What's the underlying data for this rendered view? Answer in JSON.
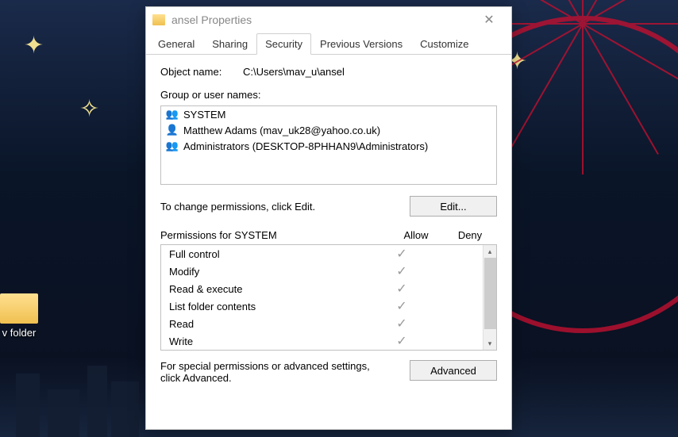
{
  "desktop": {
    "folder_label": "v folder"
  },
  "dialog": {
    "title": "ansel Properties",
    "tabs": {
      "general": "General",
      "sharing": "Sharing",
      "security": "Security",
      "previous": "Previous Versions",
      "customize": "Customize"
    },
    "object_name_label": "Object name:",
    "object_name_value": "C:\\Users\\mav_u\\ansel",
    "group_label": "Group or user names:",
    "users": [
      {
        "icon": "group-icon",
        "name": "SYSTEM"
      },
      {
        "icon": "user-icon",
        "name": "Matthew Adams (mav_uk28@yahoo.co.uk)"
      },
      {
        "icon": "group-icon",
        "name": "Administrators (DESKTOP-8PHHAN9\\Administrators)"
      }
    ],
    "change_text": "To change permissions, click Edit.",
    "edit_button": "Edit...",
    "permissions_label": "Permissions for SYSTEM",
    "allow_col": "Allow",
    "deny_col": "Deny",
    "permissions": [
      {
        "name": "Full control",
        "allow": true,
        "deny": false
      },
      {
        "name": "Modify",
        "allow": true,
        "deny": false
      },
      {
        "name": "Read & execute",
        "allow": true,
        "deny": false
      },
      {
        "name": "List folder contents",
        "allow": true,
        "deny": false
      },
      {
        "name": "Read",
        "allow": true,
        "deny": false
      },
      {
        "name": "Write",
        "allow": true,
        "deny": false
      }
    ],
    "advanced_text": "For special permissions or advanced settings, click Advanced.",
    "advanced_button": "Advanced"
  }
}
